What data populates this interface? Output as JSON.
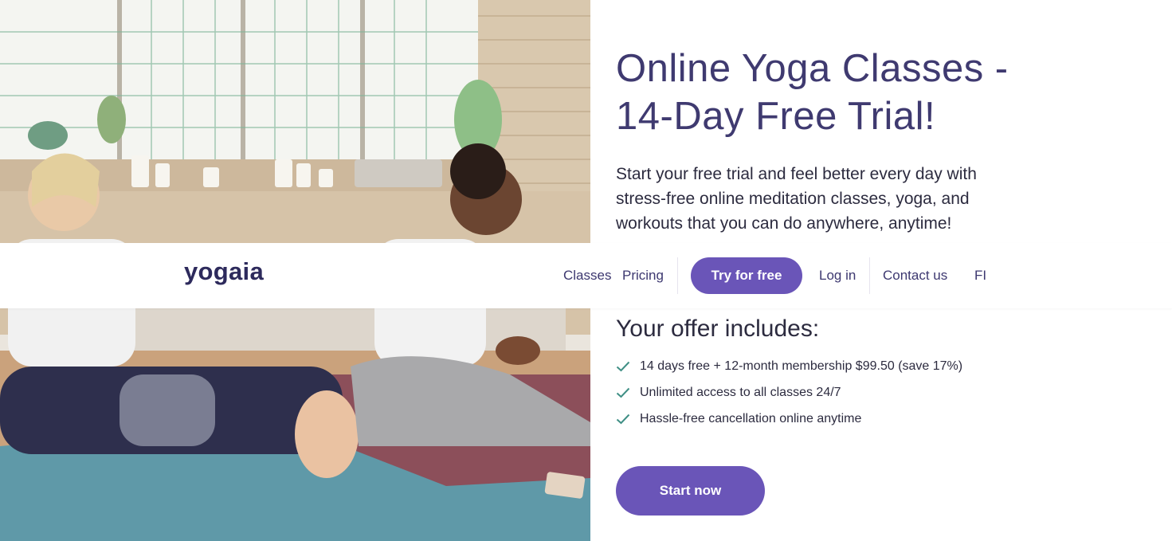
{
  "hero": {
    "image_alt": "Two women stretching on yoga mats in a bright studio",
    "title": "Online Yoga Classes - 14-Day Free Trial!",
    "lead": "Start your free trial and feel better every day with stress-free online meditation classes, yoga, and workouts that you can do anywhere, anytime!"
  },
  "nav": {
    "logo": "yogaia",
    "links": [
      {
        "label": "Classes"
      },
      {
        "label": "Pricing"
      },
      {
        "label": "Log in"
      },
      {
        "label": "Contact us"
      },
      {
        "label": "FI"
      }
    ],
    "cta_label": "Try for free"
  },
  "offer": {
    "title": "Your offer includes:",
    "items": [
      "14 days free + 12-month membership $99.50 (save 17%)",
      "Unlimited access to all classes 24/7",
      "Hassle-free cancellation online anytime"
    ],
    "check_icon": "check-icon"
  },
  "start_button_label": "Start now",
  "colors": {
    "brand_purple": "#6a55b8",
    "heading_purple": "#3f3a70",
    "logo_navy": "#2d2a5c",
    "check_teal": "#3f8f85"
  }
}
